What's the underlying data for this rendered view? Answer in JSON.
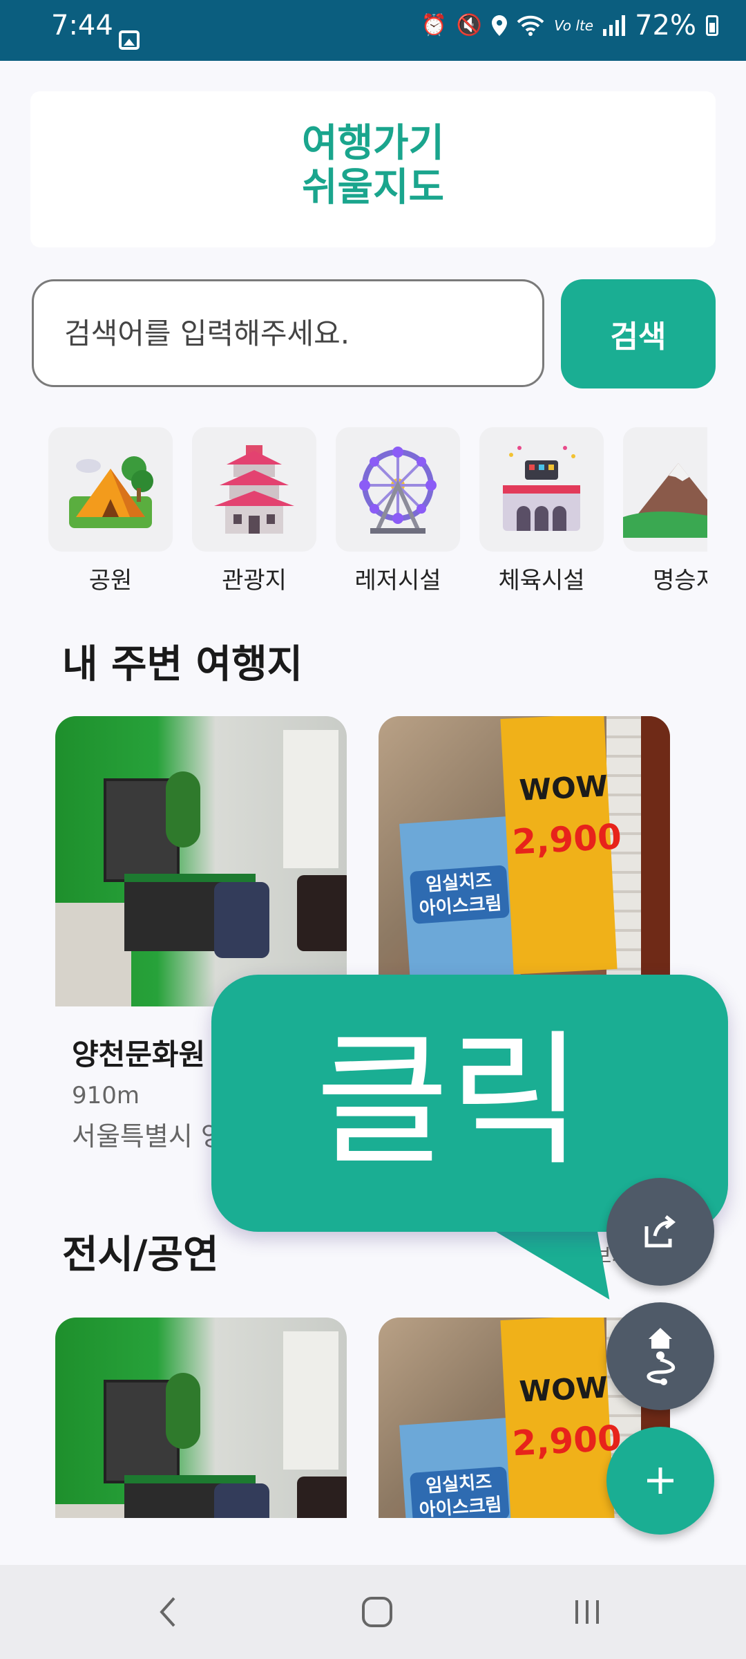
{
  "status_bar": {
    "time": "7:44",
    "battery": "72%",
    "icons": [
      "gallery-icon",
      "alarm-icon",
      "mute-icon",
      "location-icon",
      "wifi-icon",
      "volte-icon",
      "signal-icon",
      "battery-icon"
    ]
  },
  "app": {
    "logo_line1": "여행가기",
    "logo_line2": "쉬울지도",
    "accent_color": "#1aae93"
  },
  "search": {
    "placeholder": "검색어를 입력해주세요.",
    "button_label": "검색"
  },
  "categories": [
    {
      "label": "공원",
      "icon": "park-tent-icon"
    },
    {
      "label": "관광지",
      "icon": "pagoda-icon"
    },
    {
      "label": "레저시설",
      "icon": "ferris-wheel-icon"
    },
    {
      "label": "체육시설",
      "icon": "stadium-icon"
    },
    {
      "label": "명승지",
      "icon": "mountain-icon"
    }
  ],
  "sections": {
    "nearby": {
      "title": "내 주변 여행지",
      "cards": [
        {
          "name": "양천문화원",
          "distance": "910m",
          "address": "서울특별시 양"
        },
        {
          "name": "",
          "distance": "",
          "address": ""
        }
      ]
    },
    "exhibition": {
      "title": "전시/공연",
      "more_label": "더보기"
    }
  },
  "overlay": {
    "bubble_text": "클릭"
  },
  "fabs": [
    "share-icon",
    "route-home-icon",
    "plus-icon"
  ],
  "nav": [
    "back-icon",
    "home-icon",
    "recents-icon"
  ]
}
